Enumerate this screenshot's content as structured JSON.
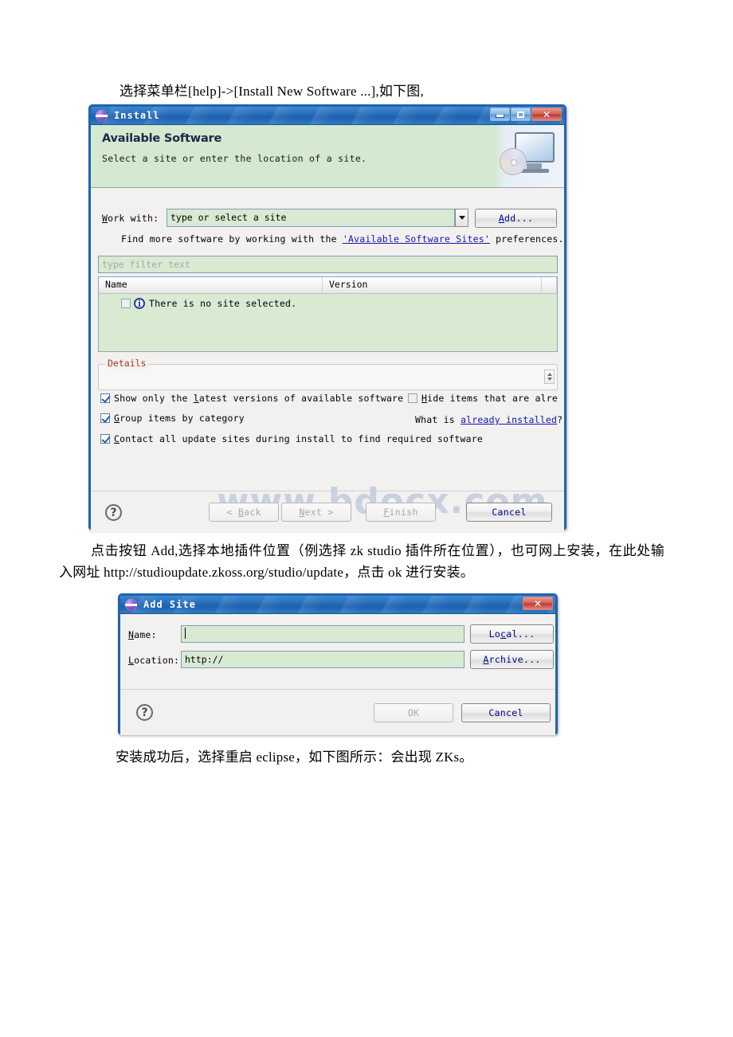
{
  "document": {
    "caption_top": "选择菜单栏[help]->[Install New Software ...],如下图,",
    "caption_middle": "点击按钮 Add,选择本地插件位置（例选择 zk studio 插件所在位置），也可网上安装，在此处输入网址 http://studioupdate.zkoss.org/studio/update，点击 ok 进行安装。",
    "caption_bottom": "安装成功后，选择重启 eclipse，如下图所示：会出现 ZKs。",
    "watermark": "www.bdocx.com"
  },
  "install_dialog": {
    "title": "Install",
    "window_buttons": {
      "minimize": "minimize-icon",
      "maximize": "maximize-icon",
      "close": "✕"
    },
    "banner": {
      "title": "Available Software",
      "subtitle": "Select a site or enter the location of a site.",
      "icon": "computer-cd-icon"
    },
    "work_with": {
      "label_pre": "W",
      "label_underline": "W",
      "label": "Work with:",
      "value": "type or select a site",
      "add_button": "Add..."
    },
    "hint": {
      "before": "Find more software by working with the ",
      "link": "'Available Software Sites'",
      "after": " preferences."
    },
    "filter_placeholder": "type filter text",
    "table": {
      "columns": [
        "Name",
        "Version"
      ],
      "rows": [
        {
          "checked": false,
          "icon": "info-icon",
          "text": "There is no site selected."
        }
      ]
    },
    "details": {
      "legend": "Details",
      "content": ""
    },
    "options": [
      {
        "label": "Show only the latest versions of available software",
        "checked": true
      },
      {
        "label": "Hide items that are alread",
        "checked": false
      },
      {
        "label": "Group items by category",
        "checked": true
      },
      {
        "label": "Contact all update sites during install to find required software",
        "checked": true
      }
    ],
    "already_installed": {
      "before": "What is ",
      "link": "already installed",
      "after": "?"
    },
    "buttons": {
      "help": "?",
      "back": "< Back",
      "next": "Next >",
      "finish": "Finish",
      "cancel": "Cancel"
    }
  },
  "add_site_dialog": {
    "title": "Add Site",
    "window_buttons": {
      "close": "✕"
    },
    "fields": [
      {
        "label": "Name:",
        "value": "",
        "button": "Local..."
      },
      {
        "label": "Location:",
        "value": "http://",
        "button": "Archive..."
      }
    ],
    "buttons": {
      "help": "?",
      "ok": "OK",
      "cancel": "Cancel"
    }
  }
}
